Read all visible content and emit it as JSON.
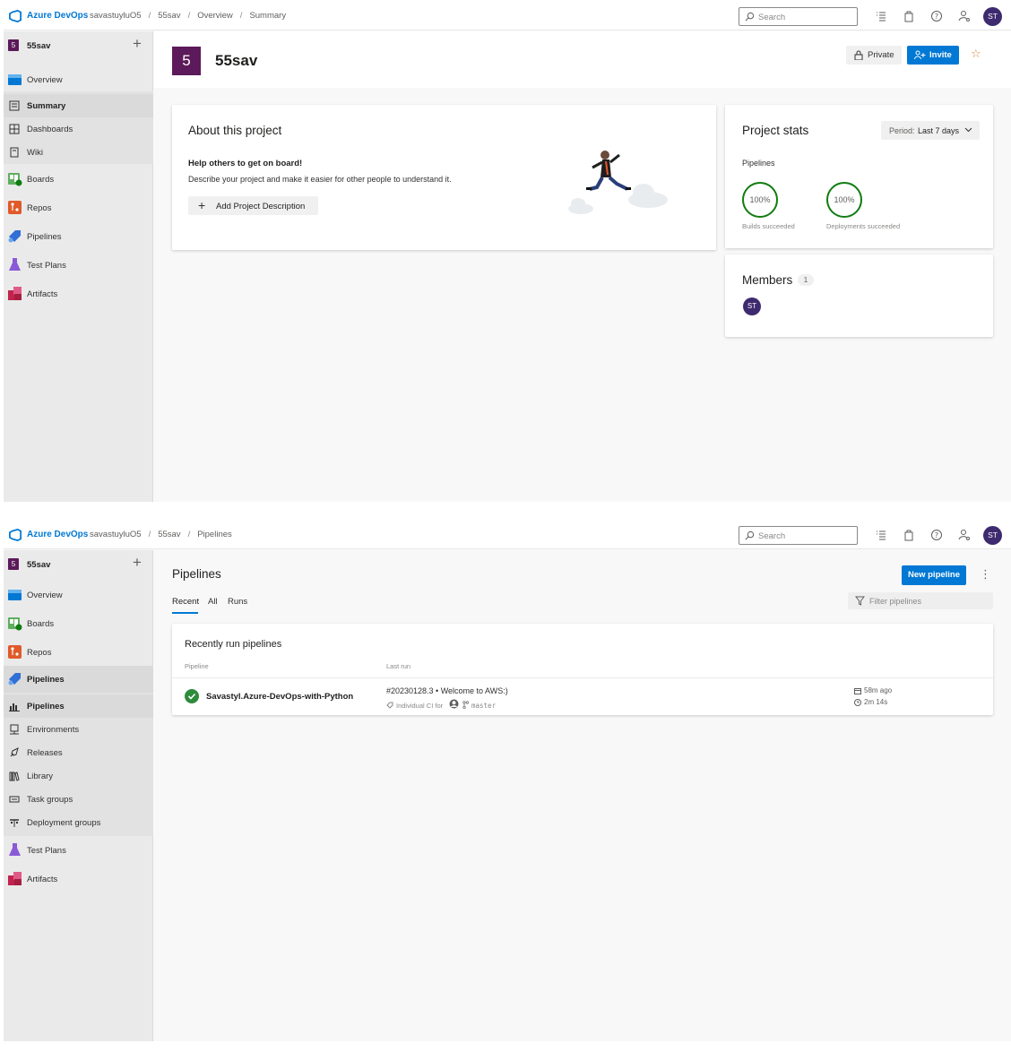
{
  "app": {
    "brand": "Azure DevOps",
    "org": "savastuyluO5",
    "user_initials": "ST"
  },
  "project": {
    "name": "55sav",
    "initial": "5"
  },
  "search": {
    "placeholder": "Search"
  },
  "screen1": {
    "breadcrumbs": [
      "savastuyluO5",
      "55sav",
      "Overview",
      "Summary"
    ],
    "sidebar": [
      {
        "label": "Overview",
        "icon": "overview-icon"
      },
      {
        "label": "Summary",
        "icon": "summary-icon"
      },
      {
        "label": "Dashboards",
        "icon": "dashboards-icon"
      },
      {
        "label": "Wiki",
        "icon": "wiki-icon"
      },
      {
        "label": "Boards",
        "icon": "boards-icon"
      },
      {
        "label": "Repos",
        "icon": "repos-icon"
      },
      {
        "label": "Pipelines",
        "icon": "pipelines-icon"
      },
      {
        "label": "Test Plans",
        "icon": "test-plans-icon"
      },
      {
        "label": "Artifacts",
        "icon": "artifacts-icon"
      }
    ],
    "header": {
      "private_label": "Private",
      "invite_label": "Invite"
    },
    "about": {
      "title": "About this project",
      "heading": "Help others to get on board!",
      "description": "Describe your project and make it easier for other people to understand it.",
      "button": "Add Project Description"
    },
    "stats": {
      "title": "Project stats",
      "period_prefix": "Period:",
      "period_value": "Last 7 days",
      "section": "Pipelines",
      "builds_pct": "100%",
      "builds_label": "Builds succeeded",
      "deploy_pct": "100%",
      "deploy_label": "Deployments succeeded"
    },
    "members": {
      "title": "Members",
      "count": "1",
      "avatars": [
        "ST"
      ]
    }
  },
  "screen2": {
    "breadcrumbs": [
      "savastuyluO5",
      "55sav",
      "Pipelines"
    ],
    "sidebar": [
      {
        "label": "Overview",
        "icon": "overview-icon"
      },
      {
        "label": "Boards",
        "icon": "boards-icon"
      },
      {
        "label": "Repos",
        "icon": "repos-icon"
      },
      {
        "label": "Pipelines",
        "icon": "pipelines-icon"
      },
      {
        "label": "Pipelines",
        "icon": "pipelines-sub-icon"
      },
      {
        "label": "Environments",
        "icon": "environments-icon"
      },
      {
        "label": "Releases",
        "icon": "releases-icon"
      },
      {
        "label": "Library",
        "icon": "library-icon"
      },
      {
        "label": "Task groups",
        "icon": "task-groups-icon"
      },
      {
        "label": "Deployment groups",
        "icon": "deployment-groups-icon"
      },
      {
        "label": "Test Plans",
        "icon": "test-plans-icon"
      },
      {
        "label": "Artifacts",
        "icon": "artifacts-icon"
      }
    ],
    "title": "Pipelines",
    "new_button": "New pipeline",
    "tabs": [
      "Recent",
      "All",
      "Runs"
    ],
    "filter_placeholder": "Filter pipelines",
    "recent": {
      "title": "Recently run pipelines",
      "col_pipeline": "Pipeline",
      "col_last_run": "Last run",
      "rows": [
        {
          "name": "Savastyl.Azure-DevOps-with-Python",
          "run": "#20230128.3 • Welcome to AWS:)",
          "trigger": "Individual CI for",
          "branch": "master",
          "ago": "58m ago",
          "duration": "2m 14s"
        }
      ]
    }
  },
  "colors": {
    "accent": "#0078d4",
    "project": "#5c1a5a",
    "success": "#107c10",
    "avatar": "#3e2a6e"
  }
}
